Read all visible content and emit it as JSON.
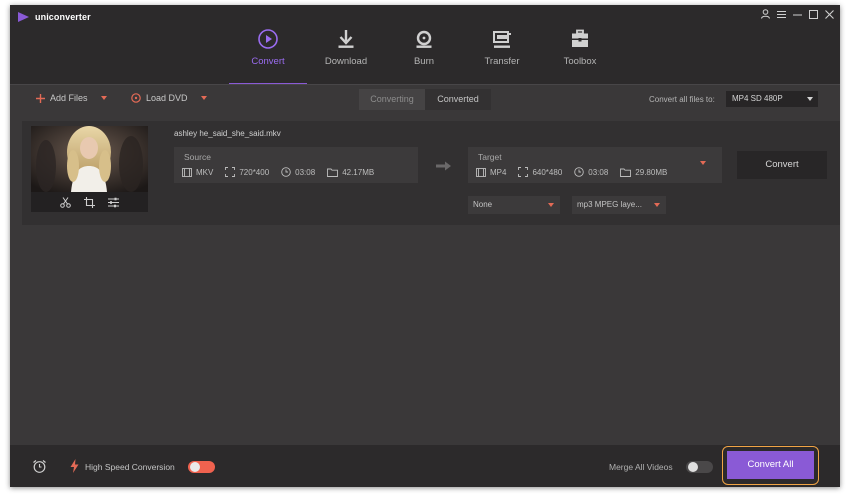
{
  "app": {
    "name": "uniconverter"
  },
  "window_controls": [
    "user-icon",
    "menu-icon",
    "minimize-icon",
    "maximize-icon",
    "close-icon"
  ],
  "nav": {
    "tabs": [
      {
        "label": "Convert",
        "icon": "convert-icon",
        "active": true
      },
      {
        "label": "Download",
        "icon": "download-icon",
        "active": false
      },
      {
        "label": "Burn",
        "icon": "burn-icon",
        "active": false
      },
      {
        "label": "Transfer",
        "icon": "transfer-icon",
        "active": false
      },
      {
        "label": "Toolbox",
        "icon": "toolbox-icon",
        "active": false
      }
    ]
  },
  "toolbar": {
    "add_files": "Add Files",
    "load_dvd": "Load DVD",
    "tab_converting": "Converting",
    "tab_converted": "Converted",
    "convert_all_label": "Convert all files to:",
    "format": "MP4 SD 480P"
  },
  "file": {
    "name": "ashley he_said_she_said.mkv",
    "source": {
      "header": "Source",
      "format": "MKV",
      "resolution": "720*400",
      "duration": "03:08",
      "size": "42.17MB"
    },
    "target": {
      "header": "Target",
      "format": "MP4",
      "resolution": "640*480",
      "duration": "03:08",
      "size": "29.80MB"
    },
    "subtitle_select": "None",
    "audio_select": "mp3 MPEG laye...",
    "convert_button": "Convert"
  },
  "bottom": {
    "high_speed": "High Speed Conversion",
    "high_speed_on": true,
    "merge": "Merge All Videos",
    "merge_on": false,
    "convert_all": "Convert All"
  },
  "colors": {
    "accent": "#8a5ad6",
    "accent_text": "#9a6cf0",
    "caret": "#e36a56",
    "toggle_on": "#f0624f",
    "highlight_ring": "#f0a445",
    "window_bg": "#3a3839",
    "bar_bg": "#2c2a2b"
  }
}
